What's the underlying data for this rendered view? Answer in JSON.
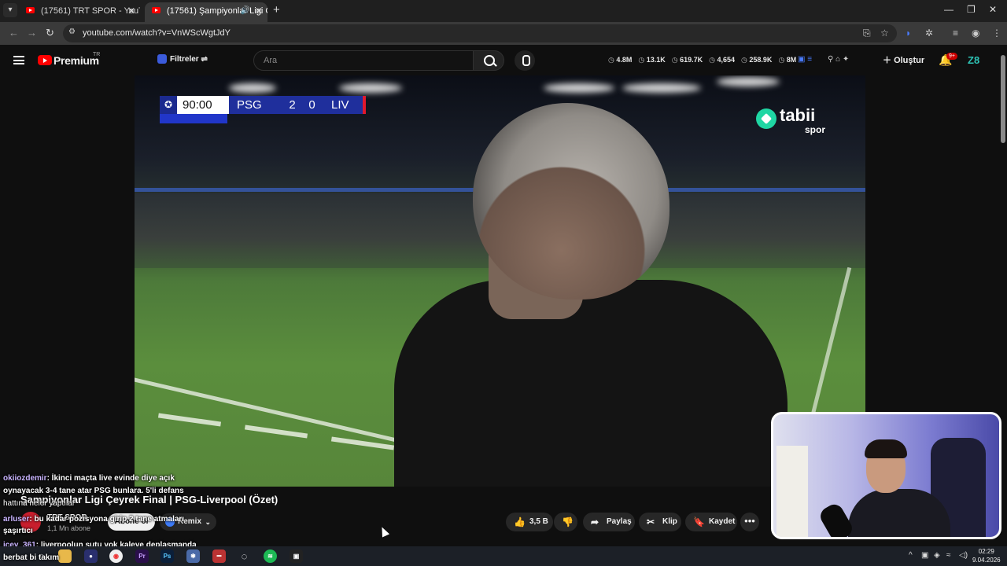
{
  "browser": {
    "tabs": [
      {
        "label": "(17561) TRT SPOR - YouTube"
      },
      {
        "label": "(17561) Şampiyonlar Ligi Ç..."
      }
    ],
    "url": "youtube.com/watch?v=VnWScWgtJdY"
  },
  "youtube": {
    "logo_text": "Premium",
    "region": "TR",
    "filters_label": "Filtreler",
    "search_placeholder": "Ara",
    "stats": [
      "4.8M",
      "13.1K",
      "619.7K",
      "4,654",
      "258.9K",
      "8M"
    ],
    "create_label": "Oluştur",
    "notif_badge": "9+",
    "avatar_text": "Z8"
  },
  "video": {
    "scorebug": {
      "time": "90:00",
      "home": "PSG",
      "home_score": "2",
      "away_score": "0",
      "away": "LIV"
    },
    "broadcaster": {
      "name": "tabii",
      "sub": "spor"
    },
    "title": "Şampiyonlar Ligi Çeyrek Final | PSG-Liverpool (Özet)",
    "channel": {
      "name": "TRT SPOR",
      "subs": "1,1 Mn abone"
    },
    "subscribe_label": "Abone ol",
    "remix_label": "Remix",
    "like_count": "3,5 B",
    "share_label": "Paylaş",
    "clip_label": "Klip",
    "save_label": "Kaydet"
  },
  "chat": [
    {
      "user": "okiiozdemir",
      "text": ": İkinci maçta live evinde diye açık"
    },
    {
      "user": "",
      "text": "oynayacak 3-4 tane atar PSG bunlara. 5'li defans"
    },
    {
      "user": "",
      "text": "hattına neler yaptılar"
    },
    {
      "user": "arluser",
      "text": ": bu kadar pozisyona girip 2 tane atmaları"
    },
    {
      "user": "",
      "text": "şaşırtıcı"
    },
    {
      "user": "icey_361",
      "text": ": liverpoolun şutu yok kaleye deplasmanda"
    },
    {
      "user": "",
      "text": "berbat bi takım"
    }
  ],
  "taskbar": {
    "time": "02:29",
    "date": "9.04.2026"
  },
  "colors": {
    "brand": "#ff0000",
    "background": "#0f0f0f",
    "tabii": "#1fd6a3"
  }
}
